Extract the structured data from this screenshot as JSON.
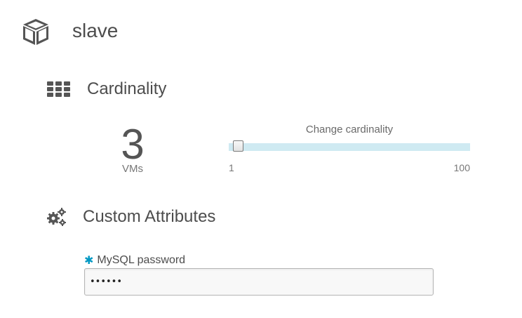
{
  "role": {
    "title": "slave",
    "icon": "cube-icon"
  },
  "cardinality": {
    "heading": "Cardinality",
    "icon": "grid-icon",
    "value": "3",
    "unit": "VMs",
    "slider": {
      "label": "Change cardinality",
      "min": "1",
      "max": "100",
      "current": 3,
      "track_color": "#cfeaf2"
    }
  },
  "custom_attributes": {
    "heading": "Custom Attributes",
    "icon": "gears-icon",
    "fields": [
      {
        "label": "MySQL password",
        "required": true,
        "required_marker": "✱",
        "type": "password",
        "value": "secret"
      }
    ]
  },
  "colors": {
    "text": "#4d4d4d",
    "required_accent": "#0098c3"
  }
}
